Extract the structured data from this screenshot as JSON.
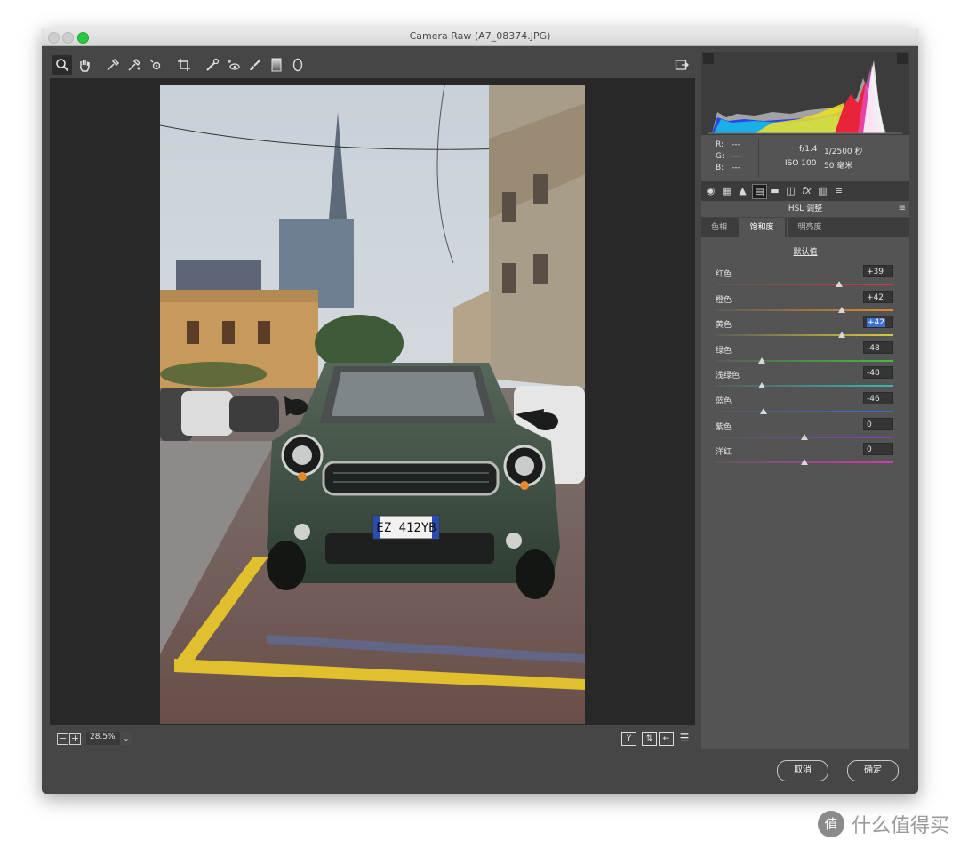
{
  "window": {
    "title": "Camera Raw (A7_08374.JPG)"
  },
  "toolbar": {
    "tools": [
      "zoom-tool-icon",
      "hand-tool-icon",
      "white-balance-tool-icon",
      "color-sampler-icon",
      "targeted-adjustment-icon",
      "crop-tool-icon",
      "spot-removal-icon",
      "red-eye-icon",
      "adjustment-brush-icon",
      "graduated-filter-icon",
      "radial-filter-icon"
    ],
    "open_preferences_icon": "open-preferences-icon"
  },
  "bottom_bar": {
    "zoom_level": "28.5%"
  },
  "info": {
    "r_label": "R:",
    "r_value": "---",
    "g_label": "G:",
    "g_value": "---",
    "b_label": "B:",
    "b_value": "---",
    "aperture": "f/1.4",
    "shutter": "1/2500 秒",
    "iso": "ISO 100",
    "focal": "50 毫米"
  },
  "panel": {
    "title": "HSL 调整",
    "tabs": [
      {
        "label": "色相",
        "active": false
      },
      {
        "label": "饱和度",
        "active": true
      },
      {
        "label": "明亮度",
        "active": false
      }
    ],
    "default_link": "默认值",
    "sliders": [
      {
        "label": "红色",
        "value": "+39",
        "numeric": 39,
        "color": "#d23a3a",
        "selected": false
      },
      {
        "label": "橙色",
        "value": "+42",
        "numeric": 42,
        "color": "#e08a2a",
        "selected": false
      },
      {
        "label": "黄色",
        "value": "+42",
        "numeric": 42,
        "color": "#d8c93a",
        "selected": true
      },
      {
        "label": "绿色",
        "value": "-48",
        "numeric": -48,
        "color": "#3fbf3a",
        "selected": false
      },
      {
        "label": "浅绿色",
        "value": "-48",
        "numeric": -48,
        "color": "#33b8b0",
        "selected": false
      },
      {
        "label": "蓝色",
        "value": "-46",
        "numeric": -46,
        "color": "#3a6ed8",
        "selected": false
      },
      {
        "label": "紫色",
        "value": "0",
        "numeric": 0,
        "color": "#8a3ad0",
        "selected": false
      },
      {
        "label": "洋红",
        "value": "0",
        "numeric": 0,
        "color": "#d03ab0",
        "selected": false
      }
    ]
  },
  "footer": {
    "cancel_label": "取消",
    "ok_label": "确定"
  },
  "photo": {
    "plate_text": "EZ 412YB"
  },
  "watermark": {
    "text": "什么值得买",
    "logo_char": "值"
  }
}
